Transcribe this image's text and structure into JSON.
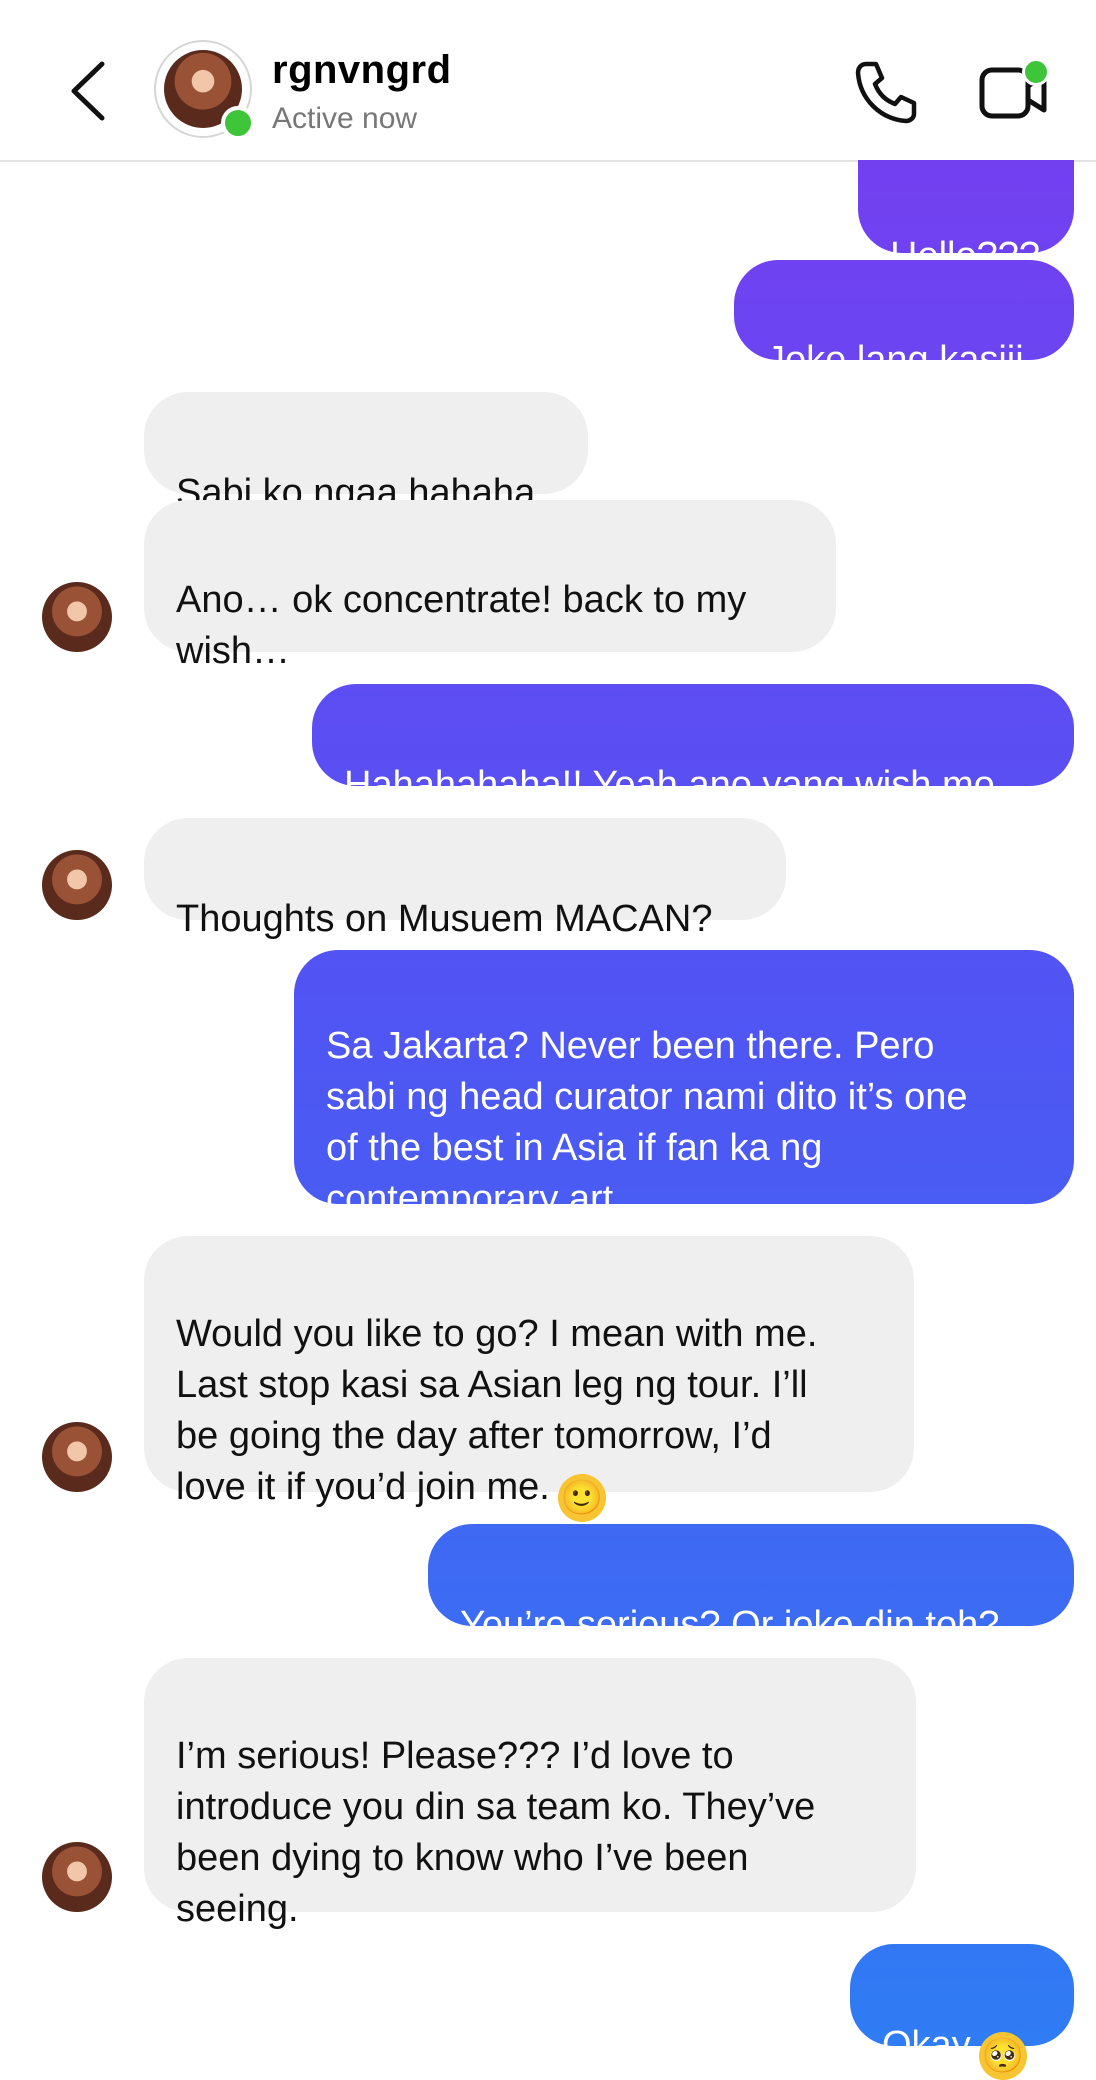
{
  "header": {
    "contact_name": "rgnvngrd",
    "status": "Active now",
    "back_icon": "chevron-left-icon",
    "call_icon": "phone-icon",
    "video_icon": "video-camera-icon",
    "online_color": "#3fc53a"
  },
  "messages": [
    {
      "from": "me",
      "text": "Hello???"
    },
    {
      "from": "me",
      "text": "Joke lang kasiii"
    },
    {
      "from": "them",
      "text": "Sabi ko ngaa hahaha"
    },
    {
      "from": "them",
      "text": "Ano… ok concentrate! back to my\nwish…"
    },
    {
      "from": "me",
      "text": "Hahahahaha!! Yeah ano yang wish mo"
    },
    {
      "from": "them",
      "text": "Thoughts on Musuem MACAN?"
    },
    {
      "from": "me",
      "text": "Sa Jakarta? Never been there. Pero\nsabi ng head curator nami dito it’s one\nof the best in Asia if fan ka ng\ncontemporary art."
    },
    {
      "from": "them",
      "text": "Would you like to go? I mean with me.\nLast stop kasi sa Asian leg ng tour. I’ll\nbe going the day after tomorrow, I’d\nlove it if you’d join me.",
      "emoji": "🙂"
    },
    {
      "from": "me",
      "text": "You’re serious? Or joke din toh?"
    },
    {
      "from": "them",
      "text": "I’m serious! Please??? I’d love to\nintroduce you din sa team ko. They’ve\nbeen dying to know who I’ve been\nseeing."
    },
    {
      "from": "me",
      "text": "Okay",
      "emoji": "🥺"
    }
  ],
  "colors": {
    "out_top": "#7a3cf0",
    "out_mid": "#4f55f3",
    "out_bottom": "#2f7cf4",
    "in_bg": "#efefef"
  }
}
